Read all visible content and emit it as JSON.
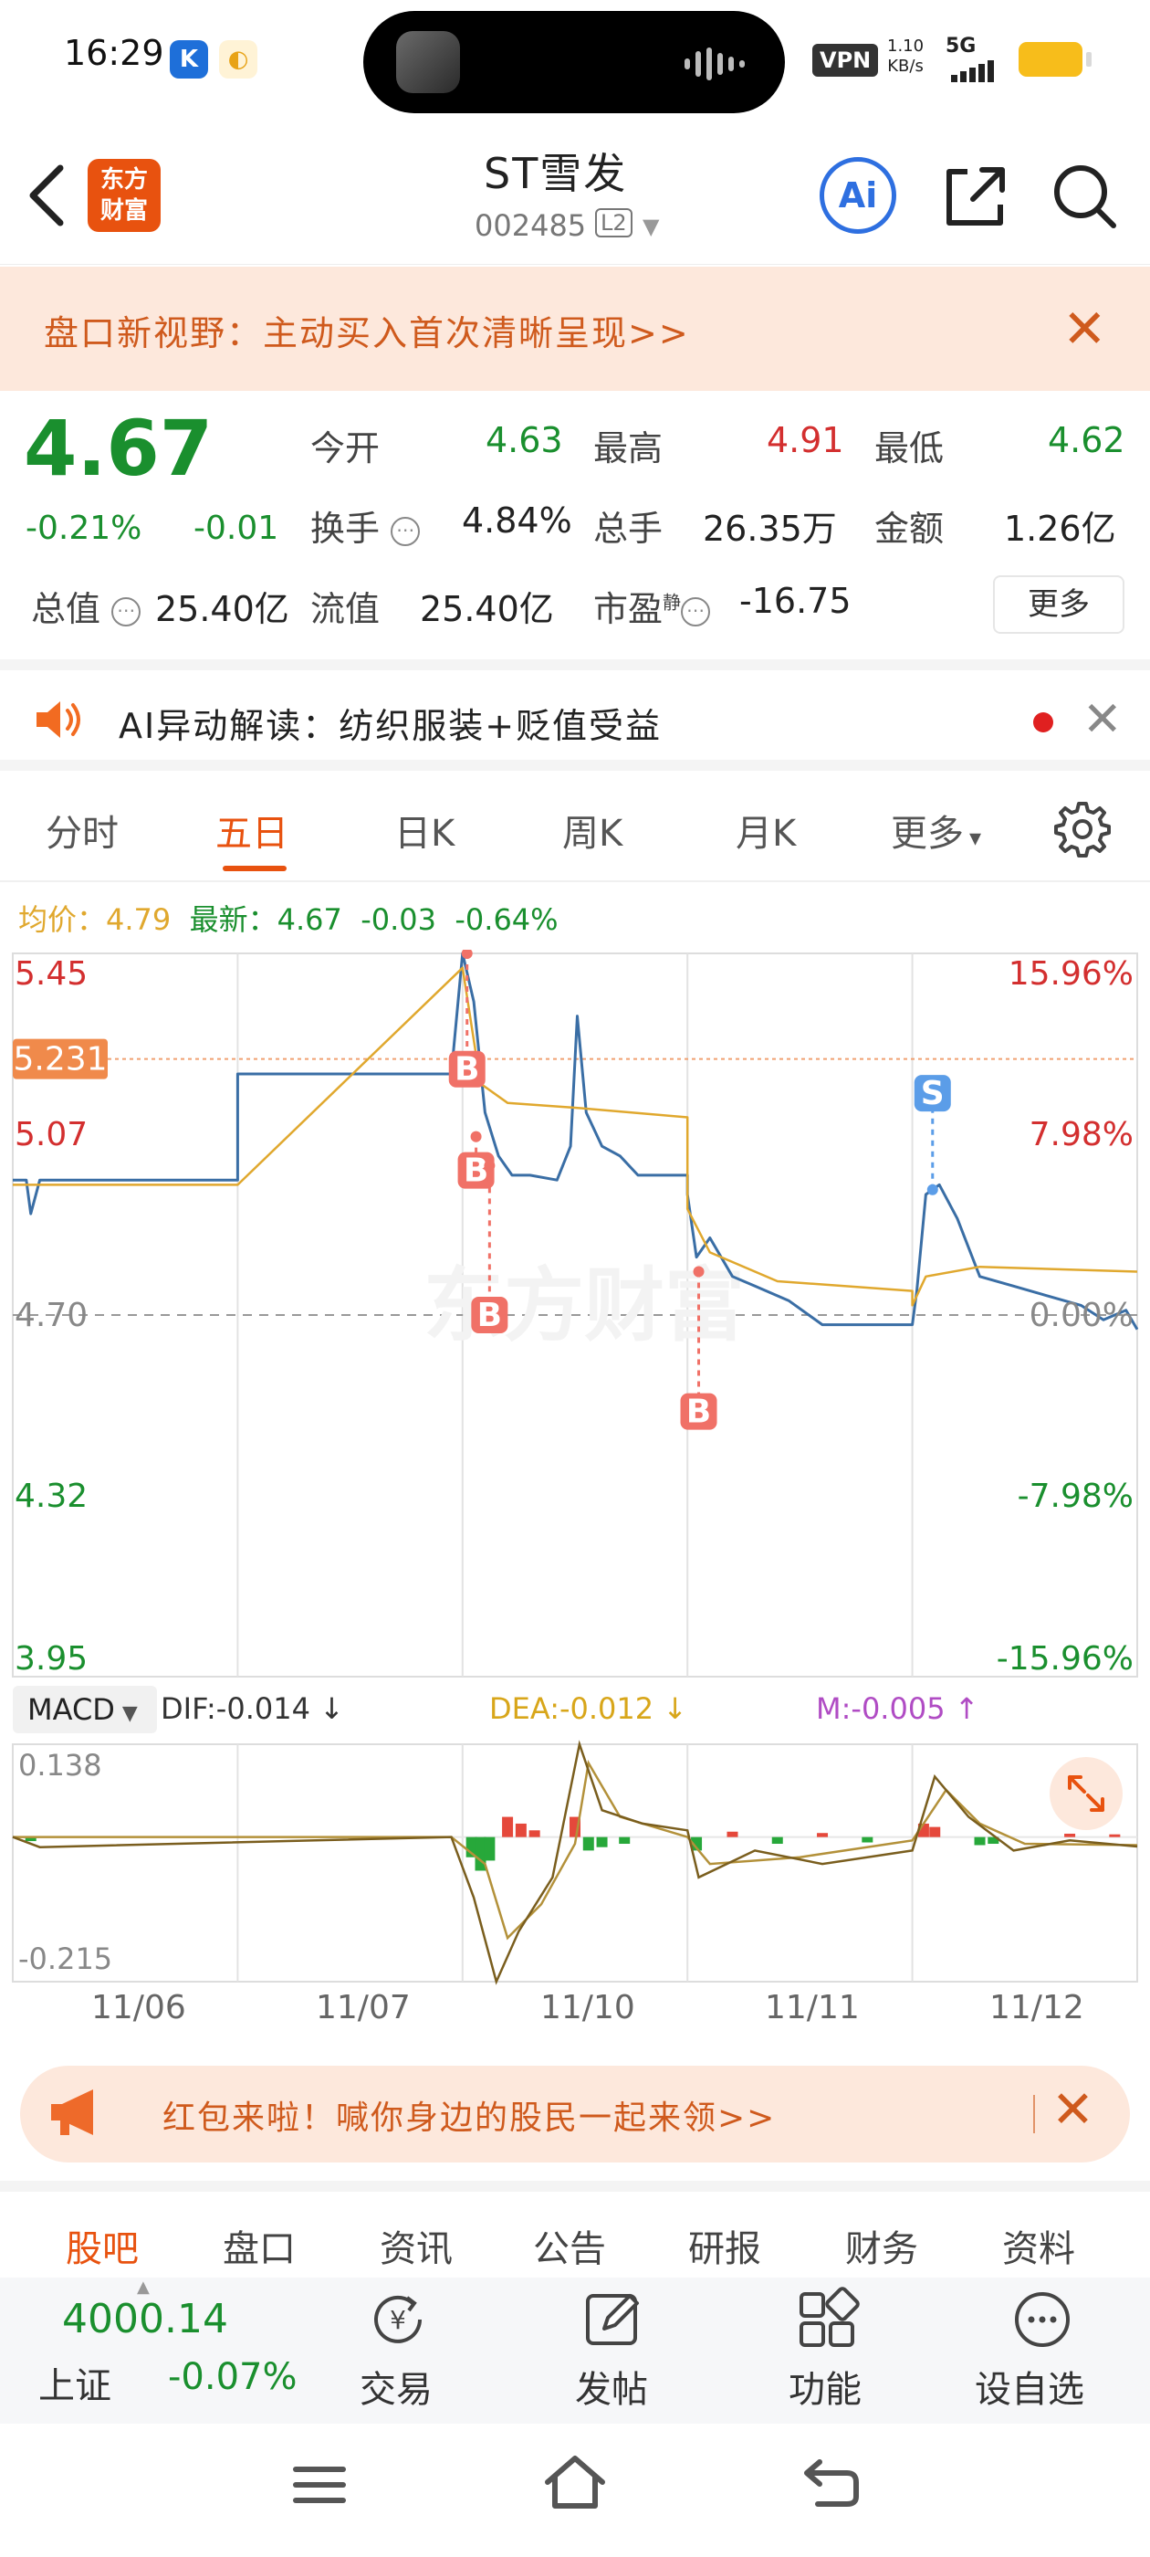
{
  "status_bar": {
    "time": "16:29",
    "vpn": "VPN",
    "net_speed_value": "1.10",
    "net_speed_unit": "KB/s",
    "network": "5G",
    "icons": [
      "app-k-icon",
      "app-bird-icon",
      "island-thumbnail",
      "audio-wave-icon",
      "signal-icon",
      "battery-icon"
    ]
  },
  "header": {
    "back_icon": "chevron-left-icon",
    "logo_line1": "东方",
    "logo_line2": "财富",
    "stock_name": "ST雪发",
    "stock_code": "002485",
    "level_badge": "L2",
    "ai_label": "Ai",
    "share_icon": "share-icon",
    "search_icon": "search-icon"
  },
  "promo": {
    "text": "盘口新视野：主动买入首次清晰呈现>>",
    "close": "✕"
  },
  "quote": {
    "price": "4.67",
    "change_pct": "-0.21%",
    "change_abs": "-0.01",
    "open_label": "今开",
    "open": "4.63",
    "high_label": "最高",
    "high": "4.91",
    "low_label": "最低",
    "low": "4.62",
    "turnover_label": "换手",
    "turnover": "4.84%",
    "volume_label": "总手",
    "volume": "26.35万",
    "amount_label": "金额",
    "amount": "1.26亿",
    "total_cap_label": "总值",
    "total_cap": "25.40亿",
    "float_cap_label": "流值",
    "float_cap": "25.40亿",
    "pe_label": "市盈",
    "pe_sup": "静",
    "pe": "-16.75",
    "more": "更多"
  },
  "ai_row": {
    "text": "AI异动解读：纺织服装+贬值受益",
    "close": "✕"
  },
  "chart_tabs": {
    "items": [
      "分时",
      "五日",
      "日K",
      "周K",
      "月K",
      "更多"
    ],
    "active": "五日",
    "more_caret": "▾"
  },
  "price_line": {
    "avg_label": "均价：",
    "avg": "4.79",
    "latest_label": "最新：",
    "latest": "4.67",
    "latest_chg": "-0.03",
    "latest_pct": "-0.64%"
  },
  "chart_data": {
    "type": "line",
    "x_label_days": [
      "11/06",
      "11/07",
      "11/10",
      "11/11",
      "11/12"
    ],
    "y_left_ticks": [
      "5.45",
      "5.07",
      "4.70",
      "4.32",
      "3.95"
    ],
    "y_right_ticks": [
      "15.96%",
      "7.98%",
      "0.00%",
      "-7.98%",
      "-15.96%"
    ],
    "ylim": [
      3.95,
      5.45
    ],
    "crosshair_label": "5.231",
    "watermark": "东方财富",
    "series": [
      {
        "name": "最新",
        "color": "#3a6ea5",
        "values": [
          {
            "x": 0.0,
            "y": 4.98
          },
          {
            "x": 0.06,
            "y": 4.98
          },
          {
            "x": 0.08,
            "y": 4.91
          },
          {
            "x": 0.12,
            "y": 4.98
          },
          {
            "x": 1.0,
            "y": 4.98
          },
          {
            "x": 1.0,
            "y": 5.2
          },
          {
            "x": 1.95,
            "y": 5.2
          },
          {
            "x": 2.0,
            "y": 5.45
          },
          {
            "x": 2.05,
            "y": 5.35
          },
          {
            "x": 2.1,
            "y": 5.12
          },
          {
            "x": 2.16,
            "y": 5.03
          },
          {
            "x": 2.22,
            "y": 4.99
          },
          {
            "x": 2.3,
            "y": 4.99
          },
          {
            "x": 2.42,
            "y": 4.98
          },
          {
            "x": 2.48,
            "y": 5.05
          },
          {
            "x": 2.51,
            "y": 5.32
          },
          {
            "x": 2.55,
            "y": 5.12
          },
          {
            "x": 2.62,
            "y": 5.05
          },
          {
            "x": 2.7,
            "y": 5.03
          },
          {
            "x": 2.78,
            "y": 4.99
          },
          {
            "x": 3.0,
            "y": 4.99
          },
          {
            "x": 3.0,
            "y": 4.95
          },
          {
            "x": 3.04,
            "y": 4.82
          },
          {
            "x": 3.1,
            "y": 4.86
          },
          {
            "x": 3.2,
            "y": 4.78
          },
          {
            "x": 3.3,
            "y": 4.76
          },
          {
            "x": 3.45,
            "y": 4.73
          },
          {
            "x": 3.6,
            "y": 4.68
          },
          {
            "x": 3.8,
            "y": 4.68
          },
          {
            "x": 4.0,
            "y": 4.68
          },
          {
            "x": 4.02,
            "y": 4.75
          },
          {
            "x": 4.06,
            "y": 4.95
          },
          {
            "x": 4.12,
            "y": 4.97
          },
          {
            "x": 4.2,
            "y": 4.9
          },
          {
            "x": 4.3,
            "y": 4.78
          },
          {
            "x": 4.45,
            "y": 4.76
          },
          {
            "x": 4.6,
            "y": 4.74
          },
          {
            "x": 4.75,
            "y": 4.72
          },
          {
            "x": 4.85,
            "y": 4.69
          },
          {
            "x": 4.95,
            "y": 4.71
          },
          {
            "x": 5.0,
            "y": 4.67
          }
        ]
      },
      {
        "name": "均价",
        "color": "#e0a82e",
        "values": [
          {
            "x": 0.0,
            "y": 4.97
          },
          {
            "x": 1.0,
            "y": 4.97
          },
          {
            "x": 2.0,
            "y": 5.42
          },
          {
            "x": 2.08,
            "y": 5.18
          },
          {
            "x": 2.2,
            "y": 5.14
          },
          {
            "x": 2.5,
            "y": 5.13
          },
          {
            "x": 3.0,
            "y": 5.11
          },
          {
            "x": 3.0,
            "y": 4.92
          },
          {
            "x": 3.1,
            "y": 4.83
          },
          {
            "x": 3.4,
            "y": 4.77
          },
          {
            "x": 4.0,
            "y": 4.75
          },
          {
            "x": 4.0,
            "y": 4.72
          },
          {
            "x": 4.06,
            "y": 4.78
          },
          {
            "x": 4.3,
            "y": 4.8
          },
          {
            "x": 5.0,
            "y": 4.79
          }
        ]
      }
    ],
    "markers": [
      {
        "label": "B",
        "x": 2.02,
        "y": 5.45,
        "badge_y": 5.21,
        "color": "#f07167"
      },
      {
        "label": "B",
        "x": 2.06,
        "y": 5.07,
        "badge_y": 5.0,
        "color": "#f07167"
      },
      {
        "label": "B",
        "x": 2.12,
        "y": 5.01,
        "badge_y": 4.7,
        "color": "#f07167"
      },
      {
        "label": "B",
        "x": 3.05,
        "y": 4.79,
        "badge_y": 4.5,
        "color": "#f07167"
      },
      {
        "label": "S",
        "x": 4.09,
        "y": 4.96,
        "badge_y": 5.16,
        "color": "#5b9de8"
      }
    ],
    "macd": {
      "selector": "MACD",
      "dif_label": "DIF:",
      "dif": "-0.014",
      "dif_arrow": "↓",
      "dea_label": "DEA:",
      "dea": "-0.012",
      "dea_arrow": "↓",
      "m_label": "M:",
      "m": "-0.005",
      "m_arrow": "↑",
      "ylim": [
        -0.215,
        0.138
      ],
      "y_top_label": "0.138",
      "y_bottom_label": "-0.215",
      "dif_series": [
        {
          "x": 0.0,
          "y": 0.0
        },
        {
          "x": 0.12,
          "y": -0.015
        },
        {
          "x": 1.95,
          "y": 0.0
        },
        {
          "x": 2.05,
          "y": -0.09
        },
        {
          "x": 2.15,
          "y": -0.215
        },
        {
          "x": 2.25,
          "y": -0.14
        },
        {
          "x": 2.4,
          "y": -0.06
        },
        {
          "x": 2.52,
          "y": 0.138
        },
        {
          "x": 2.62,
          "y": 0.04
        },
        {
          "x": 2.8,
          "y": 0.02
        },
        {
          "x": 3.0,
          "y": 0.01
        },
        {
          "x": 3.05,
          "y": -0.06
        },
        {
          "x": 3.3,
          "y": -0.02
        },
        {
          "x": 3.6,
          "y": -0.04
        },
        {
          "x": 4.0,
          "y": -0.02
        },
        {
          "x": 4.1,
          "y": 0.09
        },
        {
          "x": 4.25,
          "y": 0.03
        },
        {
          "x": 4.45,
          "y": -0.02
        },
        {
          "x": 4.7,
          "y": -0.005
        },
        {
          "x": 5.0,
          "y": -0.014
        }
      ],
      "dea_series": [
        {
          "x": 0.0,
          "y": 0.0
        },
        {
          "x": 1.95,
          "y": 0.0
        },
        {
          "x": 2.1,
          "y": -0.04
        },
        {
          "x": 2.2,
          "y": -0.15
        },
        {
          "x": 2.35,
          "y": -0.1
        },
        {
          "x": 2.5,
          "y": -0.01
        },
        {
          "x": 2.56,
          "y": 0.11
        },
        {
          "x": 2.7,
          "y": 0.03
        },
        {
          "x": 3.0,
          "y": 0.0
        },
        {
          "x": 3.1,
          "y": -0.04
        },
        {
          "x": 3.5,
          "y": -0.03
        },
        {
          "x": 4.0,
          "y": -0.005
        },
        {
          "x": 4.15,
          "y": 0.07
        },
        {
          "x": 4.3,
          "y": 0.02
        },
        {
          "x": 4.5,
          "y": -0.01
        },
        {
          "x": 5.0,
          "y": -0.012
        }
      ],
      "bars": [
        {
          "x": 0.08,
          "y": -0.006
        },
        {
          "x": 2.04,
          "y": -0.03
        },
        {
          "x": 2.08,
          "y": -0.05
        },
        {
          "x": 2.12,
          "y": -0.035
        },
        {
          "x": 2.2,
          "y": 0.03
        },
        {
          "x": 2.26,
          "y": 0.02
        },
        {
          "x": 2.32,
          "y": 0.01
        },
        {
          "x": 2.5,
          "y": 0.03
        },
        {
          "x": 2.56,
          "y": -0.02
        },
        {
          "x": 2.62,
          "y": -0.015
        },
        {
          "x": 2.72,
          "y": -0.01
        },
        {
          "x": 3.04,
          "y": -0.02
        },
        {
          "x": 3.2,
          "y": 0.008
        },
        {
          "x": 3.4,
          "y": -0.01
        },
        {
          "x": 3.6,
          "y": 0.006
        },
        {
          "x": 3.8,
          "y": -0.008
        },
        {
          "x": 4.05,
          "y": 0.02
        },
        {
          "x": 4.1,
          "y": 0.015
        },
        {
          "x": 4.3,
          "y": -0.012
        },
        {
          "x": 4.36,
          "y": -0.01
        },
        {
          "x": 4.7,
          "y": 0.005
        },
        {
          "x": 4.9,
          "y": 0.004
        }
      ]
    }
  },
  "redpack": {
    "text": "红包来啦！喊你身边的股民一起来领>>",
    "close": "✕"
  },
  "bottom_tabs": {
    "items": [
      "股吧",
      "盘口",
      "资讯",
      "公告",
      "研报",
      "财务",
      "资料"
    ],
    "active": "股吧"
  },
  "index_bar": {
    "value": "4000.14",
    "name": "上证",
    "change": "-0.07%",
    "dock": [
      "交易",
      "发帖",
      "功能",
      "设自选"
    ]
  },
  "nav": {
    "icons": [
      "menu-icon",
      "home-icon",
      "back-icon"
    ]
  }
}
